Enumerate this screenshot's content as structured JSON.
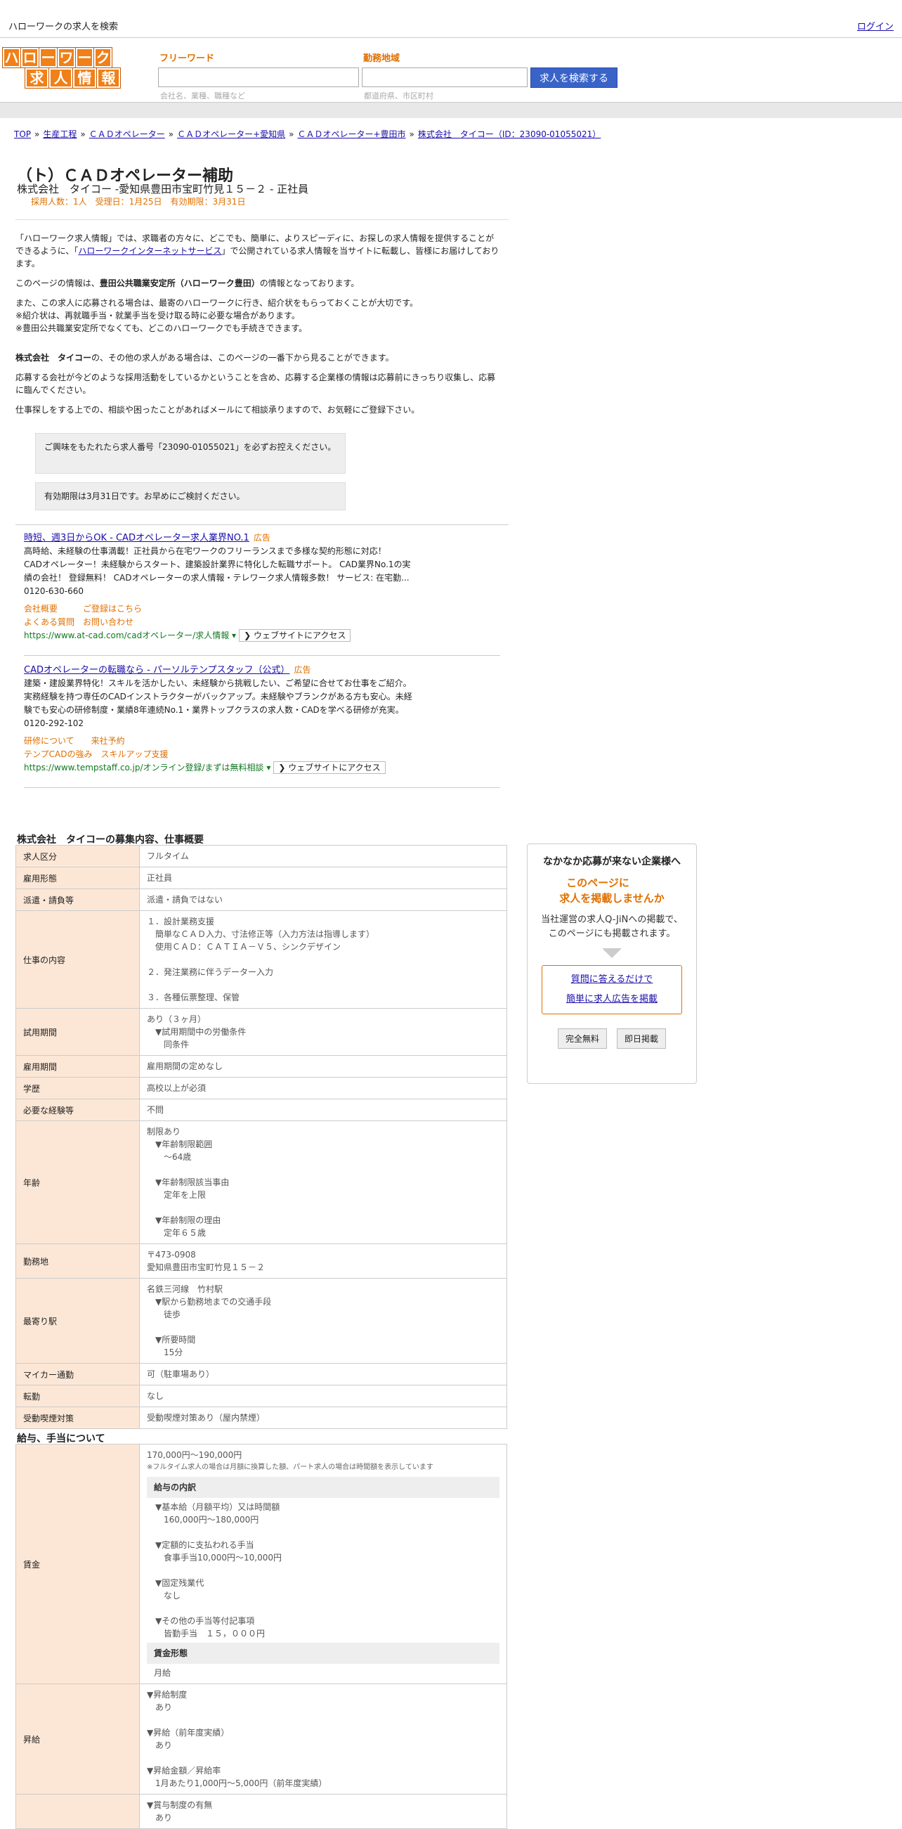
{
  "topbar": {
    "site_title": "ハローワークの求人を検索",
    "login": "ログイン"
  },
  "header": {
    "logo_row1": [
      "ハ",
      "ロ",
      "ー",
      "ワ",
      "ー",
      "ク"
    ],
    "logo_row2": [
      "求",
      "人",
      "情",
      "報"
    ],
    "keyword_label": "フリーワード",
    "keyword_hint": "会社名、業種、職種など",
    "area_label": "勤務地域",
    "area_hint": "都道府県、市区町村",
    "search_button": "求人を検索する"
  },
  "breadcrumb": [
    "TOP",
    "生産工程",
    "ＣＡＤオペレーター",
    "ＣＡＤオペレーター+愛知県",
    "ＣＡＤオペレーター+豊田市",
    "株式会社　タイコー（ID：23090-01055021）"
  ],
  "breadcrumb_sep": "»",
  "job": {
    "title": "（ト）ＣＡＤオペレーター補助",
    "company_line": "株式会社　タイコー -愛知県豊田市宝町竹見１５－２ - 正社員",
    "meta": "採用人数：1人　受理日：1月25日　有効期限：3月31日"
  },
  "intro": {
    "p1_a": "「ハローワーク求人情報」では、求職者の方々に、どこでも、簡単に、よりスピーディに、お探しの求人情報を提供することができるように、「",
    "p1_link": "ハローワークインターネットサービス",
    "p1_b": "」で公開されている求人情報を当サイトに転載し、皆様にお届けしております。",
    "p2_a": "このページの情報は、",
    "p2_bold": "豊田公共職業安定所（ハローワーク豊田）",
    "p2_b": "の情報となっております。",
    "p3_1": "また、この求人に応募される場合は、最寄のハローワークに行き、紹介状をもらっておくことが大切です。",
    "p3_2": "※紹介状は、再就職手当・就業手当を受け取る時に必要な場合があります。",
    "p3_3": "※豊田公共職業安定所でなくても、どこのハローワークでも手続きできます。",
    "p4_bold": "株式会社　タイコー",
    "p4_b": "の、その他の求人がある場合は、このページの一番下から見ることができます。",
    "p5": "応募する会社が今どのような採用活動をしているかということを含め、応募する企業様の情報は応募前にきっちり収集し、応募に臨んでください。",
    "p6": "仕事探しをする上での、相談や困ったことがあればメールにて相談承りますので、お気軽にご登録下さい。"
  },
  "notice": {
    "box1": "ご興味をもたれたら求人番号「23090-01055021」を必ずお控えください。",
    "box2": "有効期限は3月31日です。お早めにご検討ください。"
  },
  "ads": [
    {
      "title": "時短、週3日からOK - CADオペレーター求人業界NO.1",
      "tag": "広告",
      "line1": "高時給、未経験の仕事満載！正社員から在宅ワークのフリーランスまで多様な契約形態に対応！",
      "line2": "CADオペレーター！未経験からスタート、建築設計業界に特化した転職サポート。 CAD業界No.1の実",
      "line3": "績の会社！ 登録無料！ CADオペレーターの求人情報・テレワーク求人情報多数！ サービス: 在宅勤...",
      "phone": "0120-630-660",
      "sub1": "会社概要　　　ご登録はこちら",
      "sub2": "よくある質問　お問い合わせ",
      "url": "https://www.at-cad.com/cadオペレーター/求人情報 ▾",
      "visit": "❯ ウェブサイトにアクセス"
    },
    {
      "title": "CADオペレーターの転職なら - パーソルテンプスタッフ（公式）",
      "tag": "広告",
      "line1": "建築・建設業界特化！スキルを活かしたい、未経験から挑戦したい、ご希望に合せてお仕事をご紹介。",
      "line2": "実務経験を持つ専任のCADインストラクターがバックアップ。未経験やブランクがある方も安心。未経",
      "line3": "験でも安心の研修制度・業績8年連続No.1・業界トップクラスの求人数・CADを学べる研修が充実。",
      "phone": "0120-292-102",
      "sub1": "研修について　　来社予約",
      "sub2": "テンプCADの強み　スキルアップ支援",
      "url": "https://www.tempstaff.co.jp/オンライン登録/まずは無料相談 ▾",
      "visit": "❯ ウェブサイトにアクセス"
    }
  ],
  "section1_title": "株式会社　タイコーの募集内容、仕事概要",
  "table1": [
    {
      "label": "求人区分",
      "value": "フルタイム"
    },
    {
      "label": "雇用形態",
      "value": "正社員"
    },
    {
      "label": "派遣・請負等",
      "value": "派遣・請負ではない"
    },
    {
      "label": "仕事の内容",
      "value": "１．設計業務支援\n　簡単なＣＡＤ入力、寸法修正等（入力方法は指導します）\n　使用ＣＡＤ：ＣＡＴＩＡ－Ｖ５、シンクデザイン\n\n２．発注業務に伴うデーター入力\n\n３．各種伝票整理、保管"
    },
    {
      "label": "試用期間",
      "value": "あり（３ヶ月）\n　▼試用期間中の労働条件\n　　同条件"
    },
    {
      "label": "雇用期間",
      "value": "雇用期間の定めなし"
    },
    {
      "label": "学歴",
      "value": "高校以上が必須"
    },
    {
      "label": "必要な経験等",
      "value": "不問"
    },
    {
      "label": "年齢",
      "value": "制限あり\n　▼年齢制限範囲\n　　〜64歳\n\n　▼年齢制限該当事由\n　　定年を上限\n\n　▼年齢制限の理由\n　　定年６５歳"
    },
    {
      "label": "勤務地",
      "value": "〒473-0908\n愛知県豊田市宝町竹見１５－２"
    },
    {
      "label": "最寄り駅",
      "value": "名鉄三河線　竹村駅\n　▼駅から勤務地までの交通手段\n　　徒歩\n\n　▼所要時間\n　　15分"
    },
    {
      "label": "マイカー通勤",
      "value": "可（駐車場あり）"
    },
    {
      "label": "転勤",
      "value": "なし"
    },
    {
      "label": "受動喫煙対策",
      "value": "受動喫煙対策あり（屋内禁煙）"
    }
  ],
  "section2_title": "給与、手当について",
  "wage": {
    "label": "賃金",
    "amount": "170,000円〜190,000円",
    "note": "※フルタイム求人の場合は月額に換算した額、パート求人の場合は時間額を表示しています",
    "breakdown_head": "給与の内訳",
    "breakdown": "　▼基本給（月額平均）又は時間額\n　　160,000円〜180,000円\n\n　▼定額的に支払われる手当\n　　食事手当10,000円〜10,000円\n\n　▼固定残業代\n　　なし\n\n　▼その他の手当等付記事項\n　　皆勤手当　１５，０００円",
    "form_head": "賃金形態",
    "form": "月給"
  },
  "raise": {
    "label": "昇給",
    "value": "▼昇給制度\n　あり\n\n▼昇給（前年度実績）\n　あり\n\n▼昇給金額／昇給率\n　1月あたり1,000円〜5,000円（前年度実績）"
  },
  "bonus": {
    "label": "",
    "value": "▼賞与制度の有無\n　あり"
  },
  "sidebar": {
    "title": "なかなか応募が来ない企業様へ",
    "cta1": "このページに",
    "cta2": "求人を掲載しませんか",
    "desc1": "当社運営の求人Q-JiNへの掲載で、",
    "desc2": "このページにも掲載されます。",
    "link1": "質問に答えるだけで",
    "link2": "簡単に求人広告を掲載",
    "btn1": "完全無料",
    "btn2": "即日掲載"
  }
}
